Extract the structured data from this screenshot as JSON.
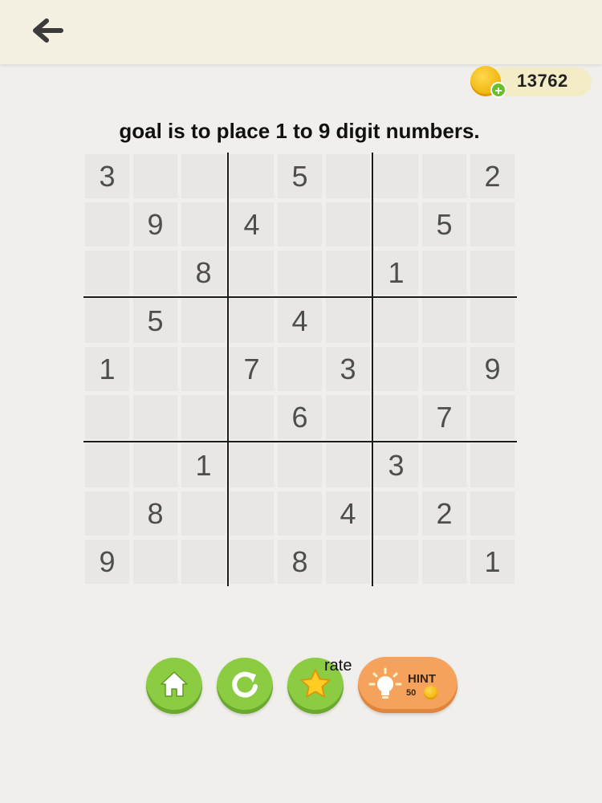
{
  "header": {
    "back_icon": "back-arrow-icon"
  },
  "coins": {
    "count": "13762",
    "plus": "+"
  },
  "instruction": "goal is to place 1 to 9 digit numbers.",
  "board": {
    "rows": [
      [
        "3",
        "",
        "",
        "",
        "5",
        "",
        "",
        "",
        "2"
      ],
      [
        "",
        "9",
        "",
        "4",
        "",
        "",
        "",
        "5",
        ""
      ],
      [
        "",
        "",
        "8",
        "",
        "",
        "",
        "1",
        "",
        ""
      ],
      [
        "",
        "5",
        "",
        "",
        "4",
        "",
        "",
        "",
        ""
      ],
      [
        "1",
        "",
        "",
        "7",
        "",
        "3",
        "",
        "",
        "9"
      ],
      [
        "",
        "",
        "",
        "",
        "6",
        "",
        "",
        "7",
        ""
      ],
      [
        "",
        "",
        "1",
        "",
        "",
        "",
        "3",
        "",
        ""
      ],
      [
        "",
        "8",
        "",
        "",
        "",
        "4",
        "",
        "2",
        ""
      ],
      [
        "9",
        "",
        "",
        "",
        "8",
        "",
        "",
        "",
        "1"
      ]
    ]
  },
  "actions": {
    "home_icon": "home-icon",
    "restart_icon": "restart-icon",
    "rate_icon": "star-icon",
    "rate_label": "rate",
    "hint_title": "HINT",
    "hint_cost": "50"
  },
  "colors": {
    "background": "#f1efeb",
    "cell": "#e8e7e3",
    "green_button": "#8ccc43",
    "hint_button": "#f5a25c"
  }
}
